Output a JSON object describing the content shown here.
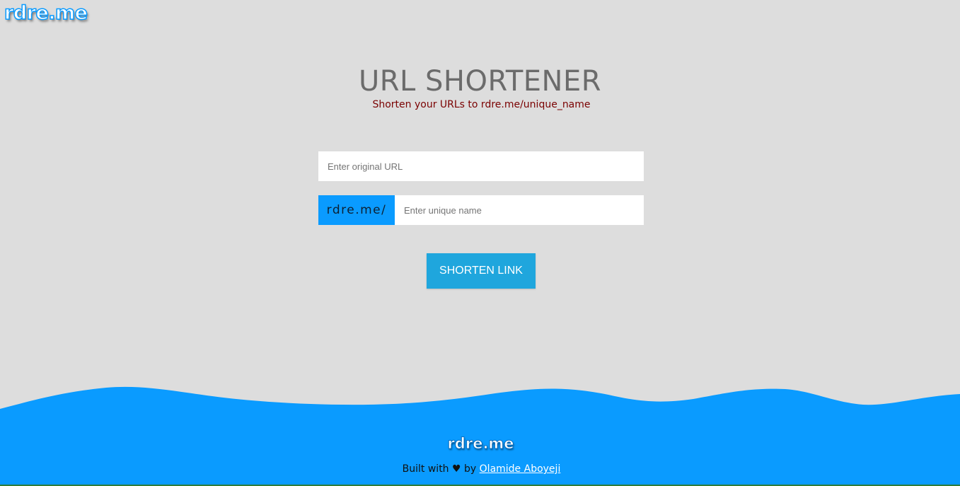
{
  "header": {
    "logo_text": "rdre.me"
  },
  "hero": {
    "title": "URL SHORTENER",
    "subtitle": "Shorten your URLs to rdre.me/unique_name"
  },
  "form": {
    "url_placeholder": "Enter original URL",
    "prefix_label": "rdre.me/",
    "name_placeholder": "Enter unique name",
    "submit_label": "SHORTEN LINK"
  },
  "footer": {
    "logo_text": "rdre.me",
    "credit_prefix": "Built with",
    "heart_glyph": "♥",
    "credit_by": "by",
    "author_link": "Olamide Aboyeji"
  },
  "colors": {
    "background": "#dddddd",
    "accent_blue": "#0a9bff",
    "button_blue": "#1fa6dd",
    "title_gray": "#6b6b6b",
    "subtitle_maroon": "#7a0000"
  }
}
